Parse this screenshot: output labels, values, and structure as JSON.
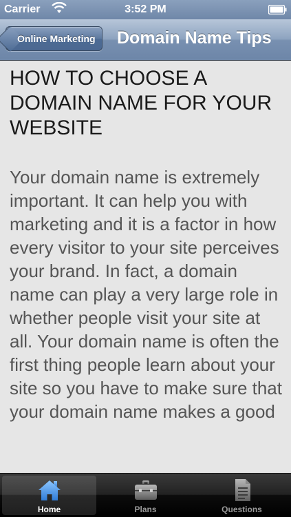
{
  "status_bar": {
    "carrier": "Carrier",
    "time": "3:52 PM"
  },
  "nav_bar": {
    "back_label": "Online Marketing",
    "title": "Domain Name Tips"
  },
  "article": {
    "title": "HOW TO CHOOSE A DOMAIN NAME FOR YOUR WEBSITE",
    "body": "Your domain name is extremely important. It can help you with marketing and it is a factor in how every visitor to your site perceives your brand. In fact, a domain name can play a very large role in whether people visit your site at all. Your domain name is often the first thing people learn about your site so you have to make sure that your domain name makes a good"
  },
  "tab_bar": {
    "tabs": [
      {
        "label": "Home",
        "icon": "home-icon",
        "selected": true
      },
      {
        "label": "Plans",
        "icon": "briefcase-icon",
        "selected": false
      },
      {
        "label": "Questions",
        "icon": "document-icon",
        "selected": false
      }
    ]
  },
  "colors": {
    "nav_bar": "#7890b1",
    "selected_tab_icon": "#3f8ddc",
    "title_text": "#1a1a1a",
    "body_text": "#555555"
  }
}
